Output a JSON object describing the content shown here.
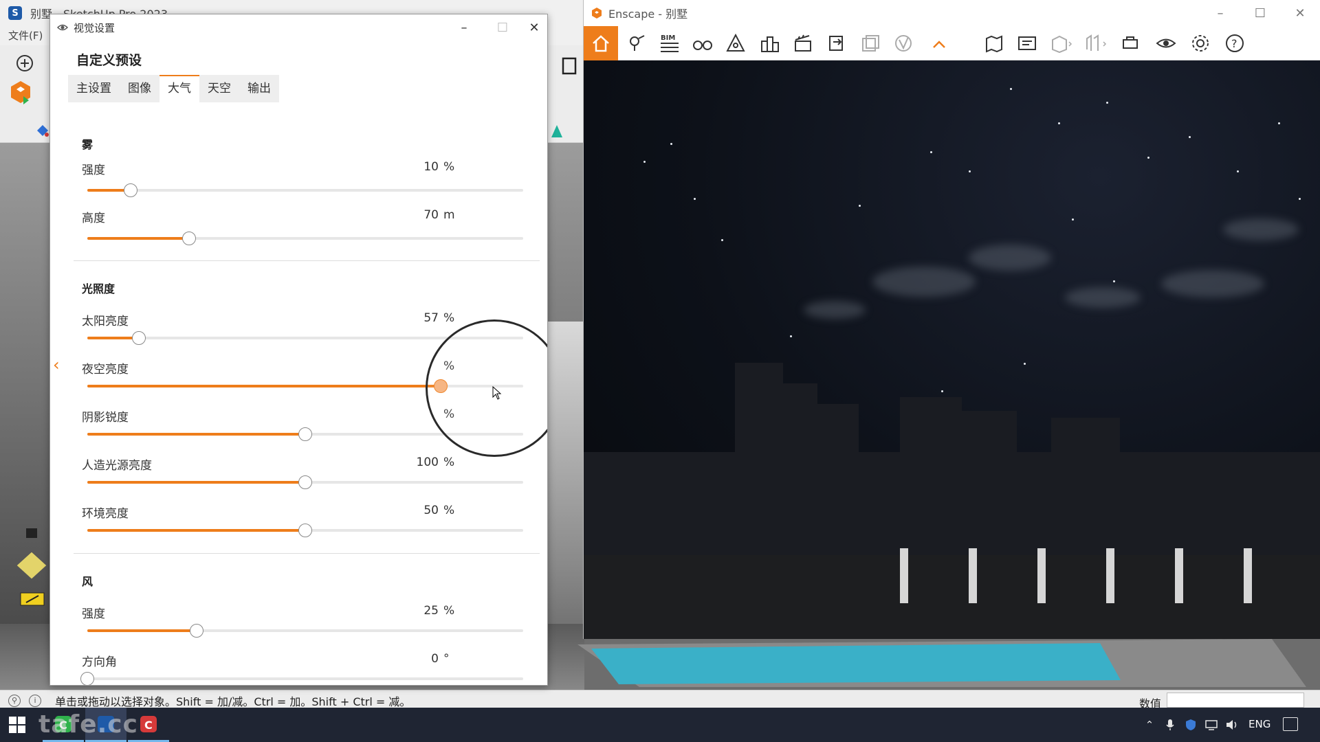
{
  "sketchup": {
    "title": "别墅 - SketchUp Pro 2023",
    "menu": "文件(F)",
    "status_hint": "单击或拖动以选择对象。Shift = 加/减。Ctrl = 加。Shift + Ctrl = 减。",
    "status_value_label": "数值"
  },
  "enscape": {
    "title": "Enscape - 别墅",
    "bim_label": "BIM",
    "accent": "#ee7d1b"
  },
  "dialog": {
    "title": "视觉设置",
    "preset_name": "自定义预设",
    "tabs": [
      {
        "label": "主设置",
        "active": false
      },
      {
        "label": "图像",
        "active": false
      },
      {
        "label": "大气",
        "active": true
      },
      {
        "label": "天空",
        "active": false
      },
      {
        "label": "输出",
        "active": false
      }
    ],
    "sections": {
      "fog": {
        "title": "雾",
        "intensity": {
          "label": "强度",
          "value": "10",
          "unit": "%",
          "fraction": 0.1
        },
        "height": {
          "label": "高度",
          "value": "70",
          "unit": "m",
          "fraction": 0.233
        }
      },
      "illumination": {
        "title": "光照度",
        "sun": {
          "label": "太阳亮度",
          "value": "57",
          "unit": "%",
          "fraction": 0.118
        },
        "night_sky": {
          "label": "夜空亮度",
          "value": "",
          "unit": "%",
          "fraction": 0.81
        },
        "shadow": {
          "label": "阴影锐度",
          "value": "",
          "unit": "%",
          "fraction": 0.5
        },
        "artificial": {
          "label": "人造光源亮度",
          "value": "100",
          "unit": "%",
          "fraction": 0.5
        },
        "ambient": {
          "label": "环境亮度",
          "value": "50",
          "unit": "%",
          "fraction": 0.5
        }
      },
      "wind": {
        "title": "风",
        "intensity": {
          "label": "强度",
          "value": "25",
          "unit": "%",
          "fraction": 0.25
        },
        "direction": {
          "label": "方向角",
          "value": "0",
          "unit": "°",
          "fraction": 0.0
        }
      }
    }
  },
  "taskbar": {
    "watermark": "tafe.cc",
    "language": "ENG"
  }
}
